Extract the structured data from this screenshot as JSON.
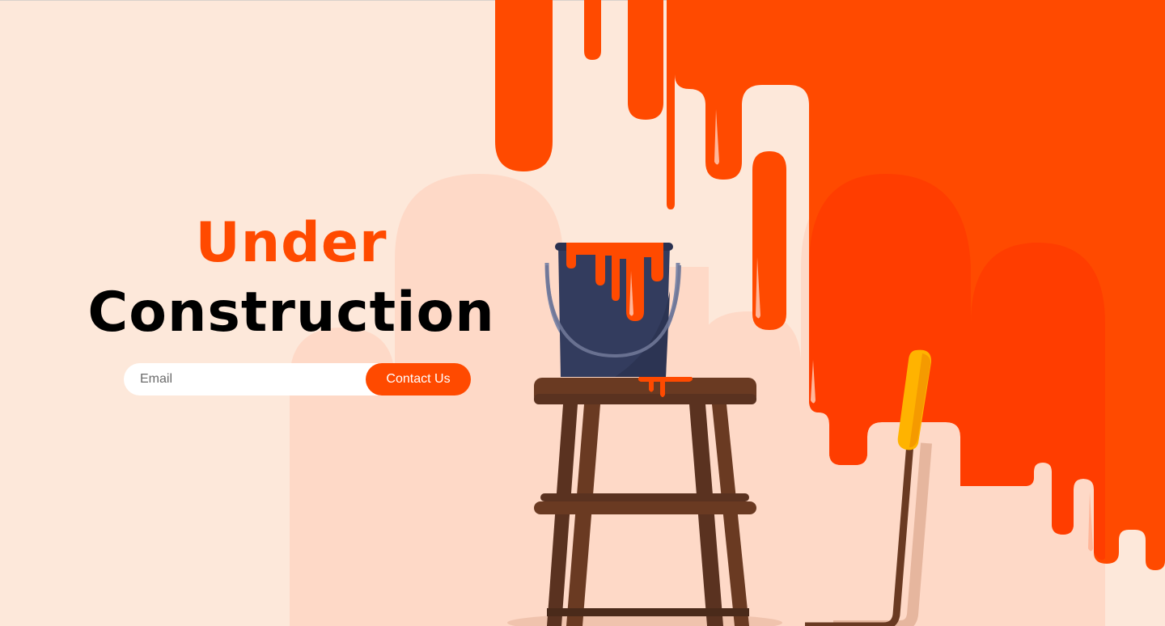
{
  "hero": {
    "title_line1": "Under",
    "title_line2": "Construction"
  },
  "form": {
    "email_placeholder": "Email",
    "contact_label": "Contact Us"
  },
  "colors": {
    "background": "#fde8da",
    "backdrop_shape": "#fed9c7",
    "paint_orange": "#ff4a00",
    "paint_orange_dark": "#ff3d00",
    "text_dark": "#000000",
    "bucket_navy": "#333c5e",
    "stool_brown": "#6a3a22",
    "roller_yellow": "#ffb300"
  },
  "icons": {
    "paint_bucket": "paint-bucket-icon",
    "stool": "stool-icon",
    "paint_roller": "paint-roller-icon"
  }
}
